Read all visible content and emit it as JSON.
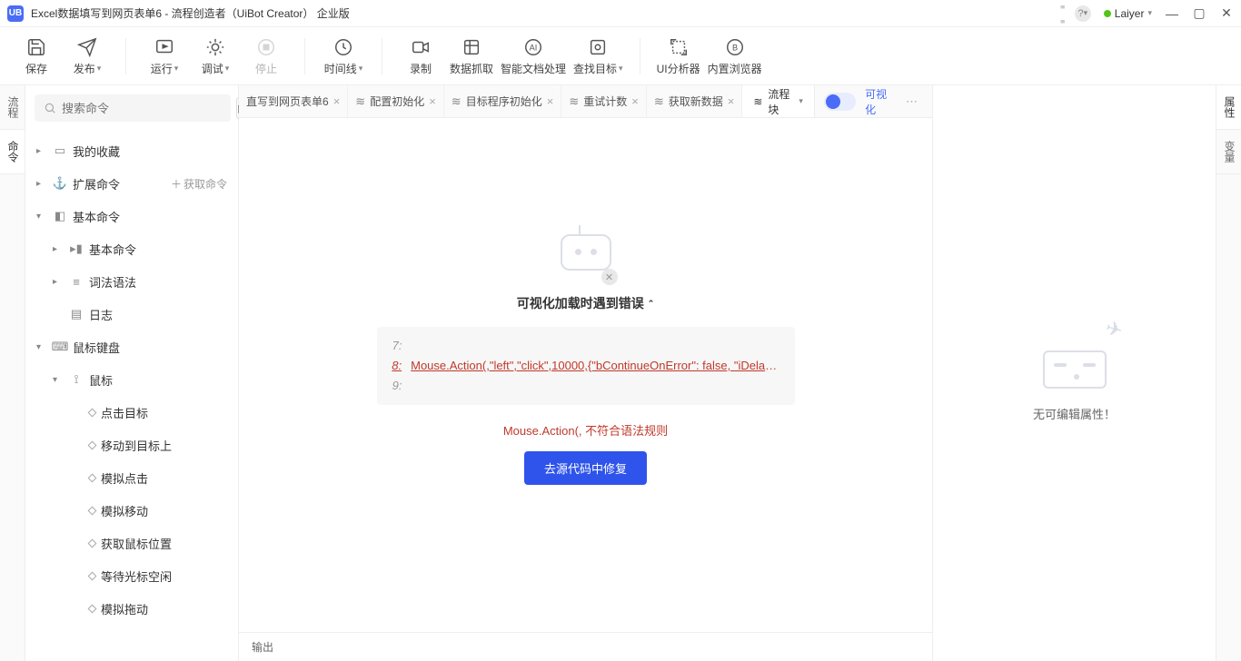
{
  "title_bar": {
    "title": "Excel数据填写到网页表单6 - 流程创造者（UiBot Creator）  企业版",
    "user": "Laiyer"
  },
  "toolbar": {
    "save": "保存",
    "publish": "发布",
    "run": "运行",
    "debug": "调试",
    "stop": "停止",
    "timeline": "时间线",
    "record": "录制",
    "data_capture": "数据抓取",
    "smart_doc": "智能文档处理",
    "find_target": "查找目标",
    "ui_analyzer": "UI分析器",
    "builtin_browser": "内置浏览器"
  },
  "left_vtabs": {
    "flow": "流程",
    "cmd": "命令"
  },
  "right_vtabs": {
    "props": "属性",
    "vars": "变量"
  },
  "search": {
    "placeholder": "搜索命令"
  },
  "tree": {
    "favorites": "我的收藏",
    "ext_cmds": "扩展命令",
    "get_cmd": "获取命令",
    "basic_cmds": "基本命令",
    "basic_cmd": "基本命令",
    "lexical": "词法语法",
    "log": "日志",
    "mouse_kb": "鼠标键盘",
    "mouse": "鼠标",
    "click_target": "点击目标",
    "move_to_target": "移动到目标上",
    "sim_click": "模拟点击",
    "sim_move": "模拟移动",
    "get_mouse_pos": "获取鼠标位置",
    "wait_cursor_idle": "等待光标空闲",
    "sim_drag": "模拟拖动"
  },
  "tabs": {
    "t1": "直写到网页表单6",
    "t2": "配置初始化",
    "t3": "目标程序初始化",
    "t4": "重试计数",
    "t5": "获取新数据",
    "current": "流程块",
    "view_label": "可视化"
  },
  "error": {
    "title": "可视化加载时遇到错误",
    "line7": "7:",
    "line8_num": "8:",
    "line8_code": "Mouse.Action(,\"left\",\"click\",10000,{\"bContinueOnError\": false, \"iDelayAf...",
    "line9": "9:",
    "msg": "Mouse.Action(, 不符合语法规则",
    "fix_btn": "去源代码中修复"
  },
  "output": {
    "label": "输出"
  },
  "right_panel": {
    "msg": "无可编辑属性！"
  }
}
